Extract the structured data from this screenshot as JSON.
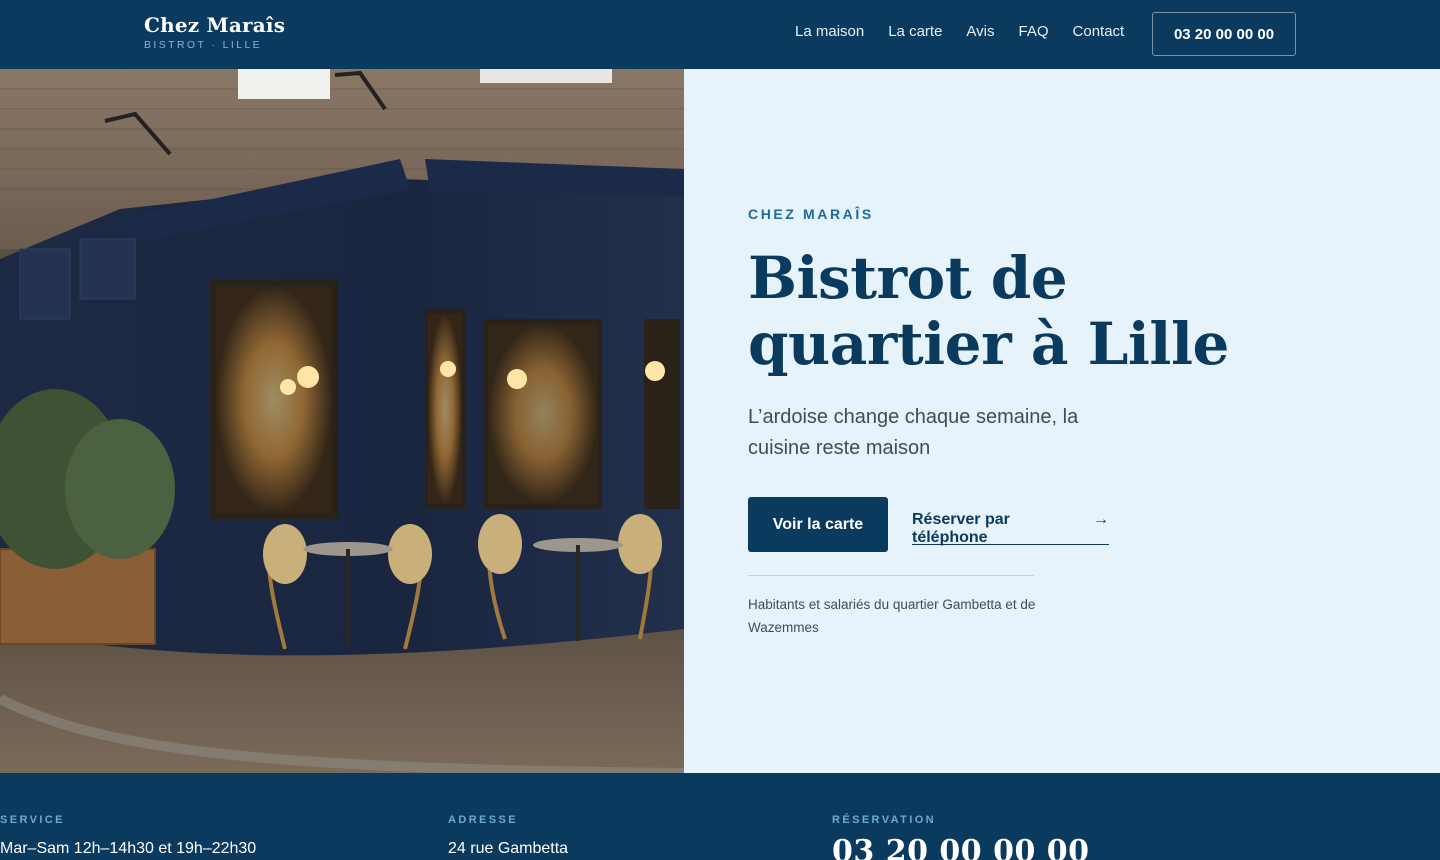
{
  "header": {
    "brand_name": "Chez Maraîs",
    "brand_tagline": "BISTROT · LILLE",
    "nav": [
      {
        "label": "La maison"
      },
      {
        "label": "La carte"
      },
      {
        "label": "Avis"
      },
      {
        "label": "FAQ"
      },
      {
        "label": "Contact"
      }
    ],
    "phone_button": "03 20 00 00 00"
  },
  "hero": {
    "image_alt": "Bistrot corner facade with terrace",
    "eyebrow": "CHEZ MARAÎS",
    "title": "Bistrot de quartier à Lille",
    "subtitle": "L’ardoise change chaque semaine, la cuisine reste maison",
    "primary_button": "Voir la carte",
    "secondary_link": "Réserver par téléphone",
    "secondary_icon": "arrow-right-icon",
    "note": "Habitants et salariés du quartier Gambetta et de Wazemmes"
  },
  "info": [
    {
      "label": "SERVICE",
      "value": "Mar–Sam 12h–14h30 et 19h–22h30"
    },
    {
      "label": "ADRESSE",
      "value": "24 rue Gambetta"
    },
    {
      "label": "RÉSERVATION",
      "value": "03 20 00 00 00"
    }
  ],
  "colors": {
    "navy": "#0b3a5f",
    "light_bg": "#e6f3fa",
    "accent": "#1e6a9a"
  }
}
